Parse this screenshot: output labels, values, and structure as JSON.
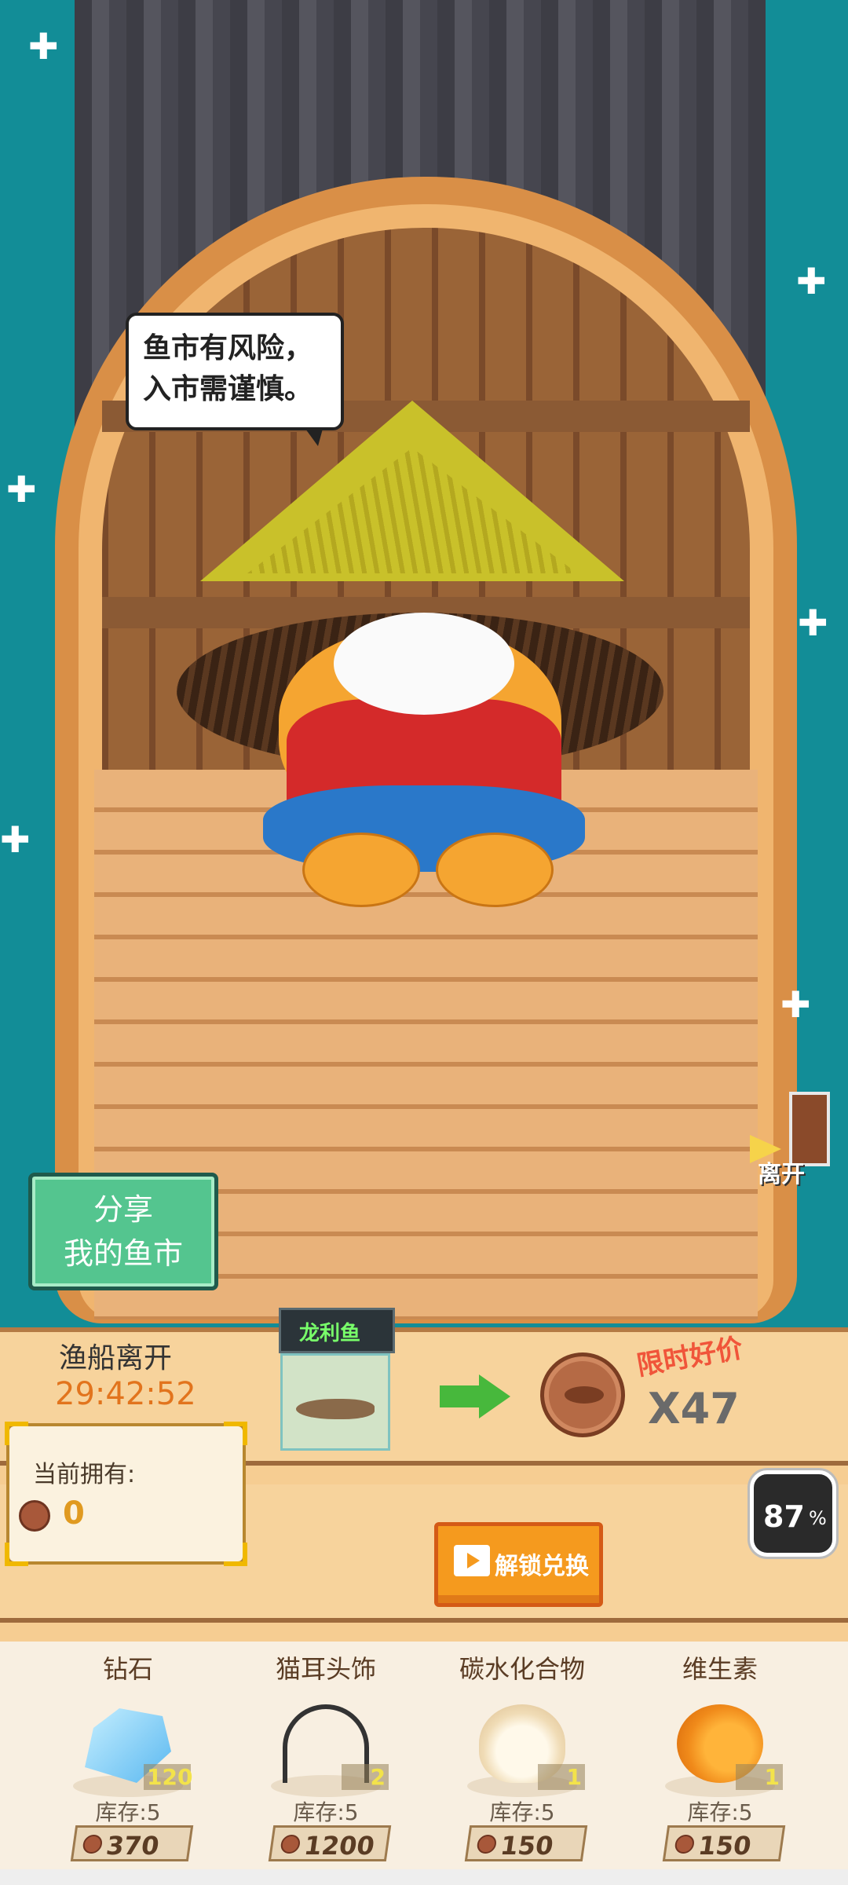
{
  "speech_bubble": {
    "line1": "鱼市有风险，",
    "line2": "入市需谨慎。"
  },
  "share_button": {
    "line1": "分享",
    "line2": "我的鱼市"
  },
  "leave_button": {
    "label": "离开"
  },
  "boat": {
    "title": "渔船离开",
    "timer": "29:42:52"
  },
  "owned": {
    "label": "当前拥有:",
    "value": "0"
  },
  "trade": {
    "fish_name": "龙利鱼",
    "promo": "限时好价",
    "multiplier": "X47"
  },
  "unlock_button": {
    "label": "解锁兑换"
  },
  "progress": {
    "percent": "87",
    "symbol": "%"
  },
  "shop": {
    "items": [
      {
        "name": "钻石",
        "qty": "120",
        "stock": "库存:5",
        "price": "370",
        "icon": "diamond-icon"
      },
      {
        "name": "猫耳头饰",
        "qty": "2",
        "stock": "库存:5",
        "price": "1200",
        "icon": "cat-ear-headband-icon"
      },
      {
        "name": "碳水化合物",
        "qty": "1",
        "stock": "库存:5",
        "price": "150",
        "icon": "steamed-bun-icon"
      },
      {
        "name": "维生素",
        "qty": "1",
        "stock": "库存:5",
        "price": "150",
        "icon": "orange-icon"
      }
    ]
  },
  "colors": {
    "sea": "#128d97",
    "accent_orange": "#e2741d",
    "share_green": "#54c58f",
    "unlock_orange": "#f59a1e"
  }
}
